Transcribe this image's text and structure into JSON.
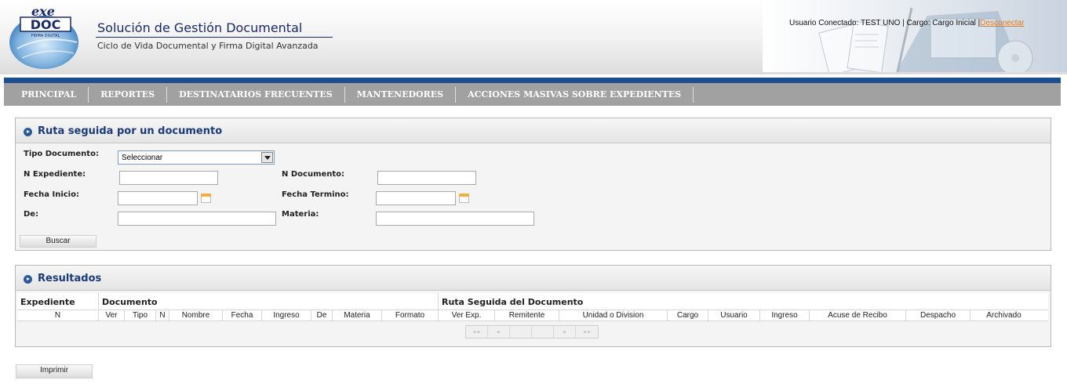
{
  "header": {
    "logo_text_top": "exe",
    "logo_text_main": "DOC",
    "logo_text_sub": "FIRMA DIGITAL",
    "title": "Solución de Gestión Documental",
    "subtitle": "Ciclo de Vida Documental y Firma Digital Avanzada",
    "user_info": "Usuario Conectado: TEST UNO | Cargo: Cargo Inicial |",
    "logout_label": "Desconectar",
    "colors": {
      "title": "#1b2a66",
      "logout_link": "#e47a1e"
    }
  },
  "nav": {
    "items": [
      {
        "label": "PRINCIPAL"
      },
      {
        "label": "REPORTES"
      },
      {
        "label": "DESTINATARIOS FRECUENTES"
      },
      {
        "label": "MANTENEDORES"
      },
      {
        "label": "ACCIONES MASIVAS SOBRE EXPEDIENTES"
      }
    ],
    "colors": {
      "bar": "#a1a1a1",
      "topline": "#1c4f8f"
    }
  },
  "search": {
    "title": "Ruta seguida por un documento",
    "tipo_documento_label": "Tipo Documento:",
    "tipo_documento_value": "Seleccionar",
    "n_expediente_label": "N Expediente:",
    "n_expediente_value": "",
    "n_documento_label": "N Documento:",
    "n_documento_value": "",
    "fecha_inicio_label": "Fecha Inicio:",
    "fecha_inicio_value": "",
    "fecha_termino_label": "Fecha Termino:",
    "fecha_termino_value": "",
    "de_label": "De:",
    "de_value": "",
    "materia_label": "Materia:",
    "materia_value": "",
    "search_button": "Buscar"
  },
  "results": {
    "title": "Resultados",
    "groups": [
      "Expediente",
      "Documento",
      "Ruta Seguida del Documento"
    ],
    "columns": [
      "N",
      "Ver",
      "Tipo",
      "N",
      "Nombre",
      "Fecha",
      "Ingreso",
      "De",
      "Materia",
      "Formato",
      "Ver Exp.",
      "Remitente",
      "Unidad o Division",
      "Cargo",
      "Usuario",
      "Ingreso",
      "Acuse de Recibo",
      "Despacho",
      "Archivado"
    ],
    "pager": {
      "first": "««",
      "prev": "«",
      "next": "»",
      "last": "»»",
      "page_value": "",
      "page_count": ""
    },
    "rows": []
  },
  "footer": {
    "print_button": "Imprimir"
  }
}
